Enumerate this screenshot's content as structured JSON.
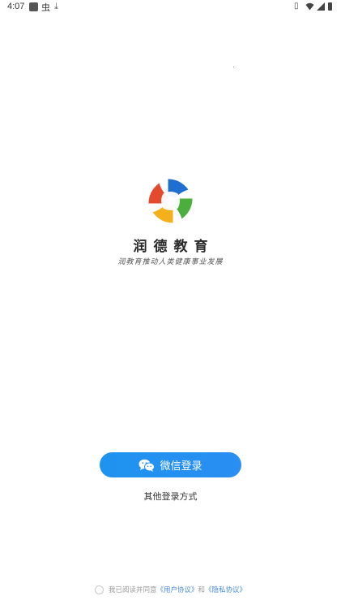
{
  "status_bar": {
    "time": "4:07",
    "bug_glyph": "虫",
    "download_glyph": "⤓",
    "vibrate_glyph": "▯",
    "icons": [
      "square-notification-icon",
      "bug-icon",
      "download-icon",
      "vibrate-icon",
      "wifi-icon",
      "signal-icon",
      "battery-icon"
    ]
  },
  "brand": {
    "app_name": "润德教育",
    "slogan": "润教育推动人类健康事业发展",
    "logo_colors": [
      "#e64a2e",
      "#f4b01b",
      "#4cae3c",
      "#1e6fd0"
    ]
  },
  "login": {
    "wechat_button_label": "微信登录",
    "other_login_label": "其他登录方式",
    "button_color": "#1e93f0"
  },
  "agreement": {
    "prefix": "我已阅读并同意",
    "user_agreement": "《用户协议》",
    "conjunction": "和",
    "privacy_policy": "《隐私协议》"
  }
}
